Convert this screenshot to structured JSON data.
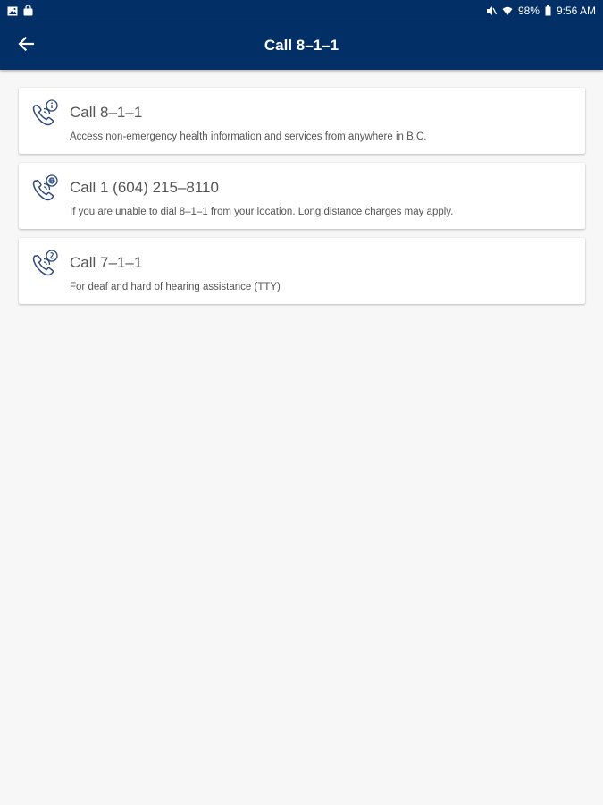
{
  "status_bar": {
    "left_icons": [
      "image-icon",
      "shopping-bag-icon"
    ],
    "right_icons": [
      "mute-icon",
      "wifi-icon",
      "battery-icon"
    ],
    "battery": "98%",
    "time": "9:56 AM"
  },
  "app_bar": {
    "back_icon": "arrow-left-icon",
    "title": "Call 8–1–1"
  },
  "options": [
    {
      "icon": "phone-info-icon",
      "title": "Call 8–1–1",
      "subtitle": "Access non-emergency health information and services from anywhere in B.C."
    },
    {
      "icon": "phone-globe-icon",
      "title": "Call 1 (604) 215–8110",
      "subtitle": "If you are unable to dial 8–1–1 from your location. Long distance charges may apply."
    },
    {
      "icon": "phone-tty-icon",
      "title": "Call 7–1–1",
      "subtitle": "For deaf and hard of hearing assistance (TTY)"
    }
  ],
  "colors": {
    "primary": "#012f66",
    "background": "#f7f7f7",
    "card": "#ffffff",
    "text": "#555555",
    "icon": "#2d4a7c"
  }
}
